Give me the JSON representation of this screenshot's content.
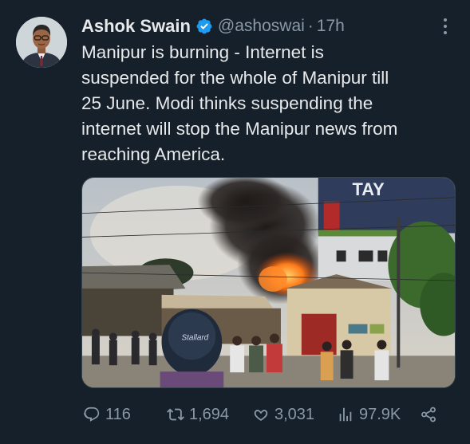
{
  "tweet": {
    "author": {
      "display_name": "Ashok Swain",
      "handle": "@ashoswai",
      "verified": true,
      "avatar_icon": "avatar"
    },
    "separator": "·",
    "time": "17h",
    "text": "Manipur is burning - Internet is\nsuspended for the whole of Manipur till\n25 June. Modi thinks suspending the\ninternet will stop the Manipur news from\nreaching America.",
    "media": {
      "sign_text": "TAY",
      "cap_text": "Stallard"
    },
    "actions": {
      "replies": "116",
      "retweets": "1,694",
      "likes": "3,031",
      "views": "97.9K"
    }
  },
  "colors": {
    "background": "#15202b",
    "text_primary": "#e7e9ea",
    "text_secondary": "#8b98a5",
    "verified_badge": "#1d9bf0"
  },
  "icons": {
    "more": "more-icon",
    "reply": "reply-icon",
    "retweet": "retweet-icon",
    "like": "heart-icon",
    "views": "views-icon",
    "share": "share-icon",
    "verified": "verified-badge-icon"
  }
}
